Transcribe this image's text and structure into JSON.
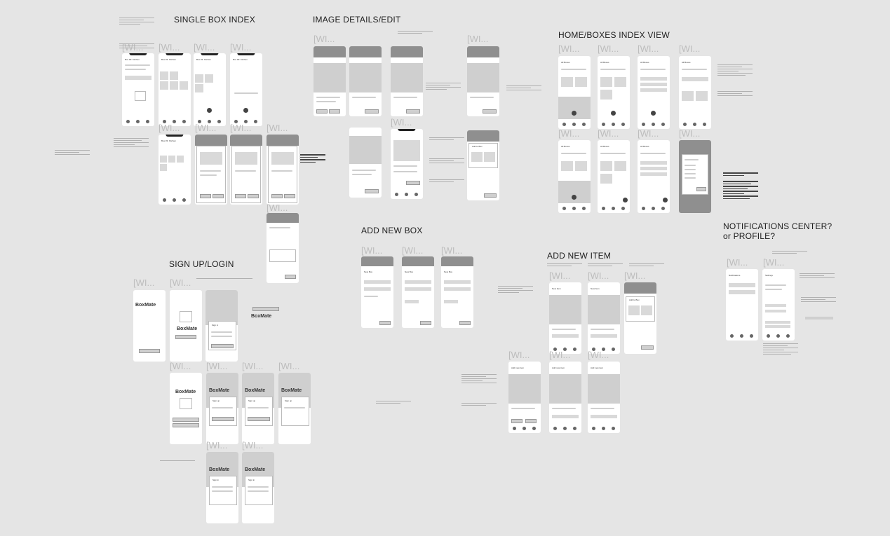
{
  "sections": {
    "single_box_index": "SINGLE BOX INDEX",
    "image_details_edit": "IMAGE DETAILS/EDIT",
    "home_boxes_index": "HOME/BOXES INDEX VIEW",
    "add_new_box": "ADD NEW BOX",
    "add_new_item": "ADD NEW ITEM",
    "sign_up_login": "SIGN UP/LOGIN",
    "notifications": "NOTIFICATIONS CENTER?",
    "notifications_sub": "or PROFILE?"
  },
  "frame_label": "[WI...",
  "app_name": "BoxMate",
  "screens": {
    "box_kitchen": "Box #3: Kitchen",
    "all_boxes": "All Boxes",
    "new_box": "New Box",
    "new_item": "New Item",
    "add_new_item": "Add new item",
    "add_to_box": "Add to Box",
    "notifications": "Notifications",
    "settings": "Settings",
    "sign_in": "Sign in",
    "sign_up": "Sign up"
  },
  "colors": {
    "canvas": "#e5e5e5",
    "placeholder": "#cfcfcf",
    "header_dark": "#8f8f8f",
    "phone": "#ffffff",
    "label_faded": "#bdbdbd"
  },
  "icons": [
    "cube-icon",
    "plus-icon",
    "close-icon",
    "home-icon"
  ]
}
